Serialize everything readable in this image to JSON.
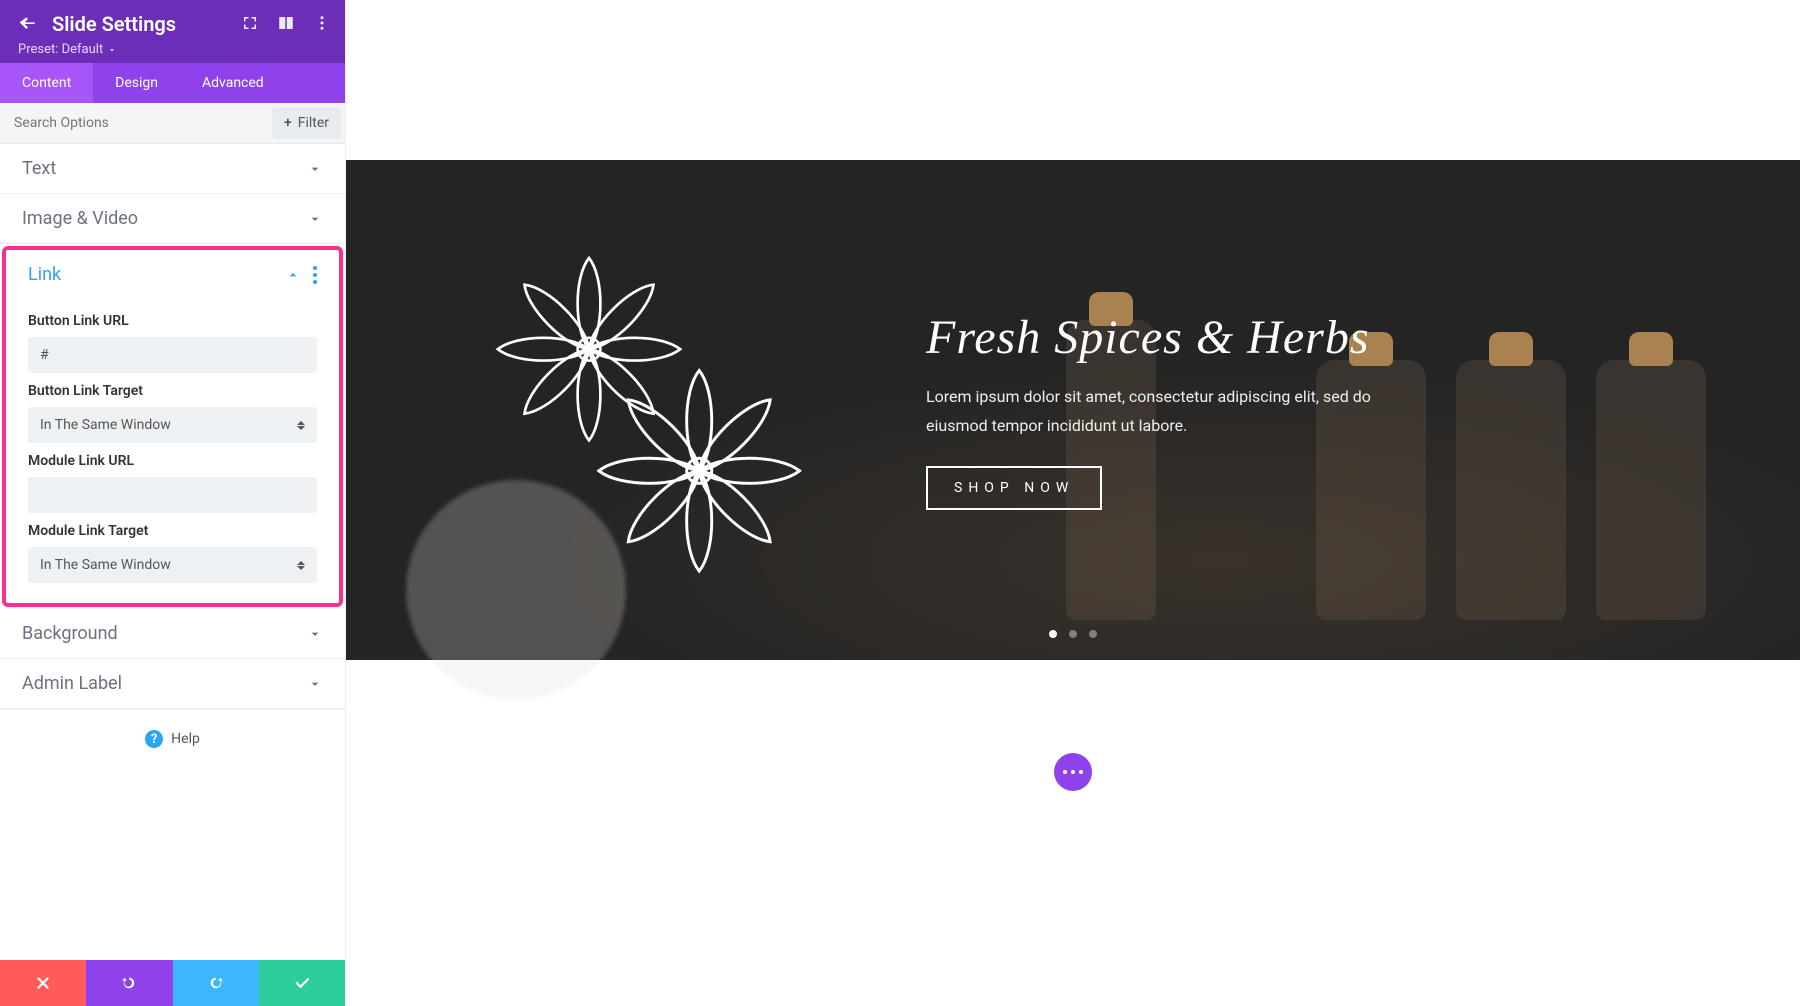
{
  "panel": {
    "title": "Slide Settings",
    "preset_label": "Preset: Default"
  },
  "tabs": {
    "content": "Content",
    "design": "Design",
    "advanced": "Advanced"
  },
  "search": {
    "placeholder": "Search Options",
    "filter_label": "Filter"
  },
  "sections": {
    "text": "Text",
    "image_video": "Image & Video",
    "link": "Link",
    "background": "Background",
    "admin_label": "Admin Label"
  },
  "link": {
    "button_url_label": "Button Link URL",
    "button_url_value": "#",
    "button_target_label": "Button Link Target",
    "button_target_value": "In The Same Window",
    "module_url_label": "Module Link URL",
    "module_url_value": "",
    "module_target_label": "Module Link Target",
    "module_target_value": "In The Same Window"
  },
  "help_label": "Help",
  "hero": {
    "title": "Fresh Spices & Herbs",
    "desc": "Lorem ipsum dolor sit amet, consectetur adipiscing elit, sed do eiusmod tempor incididunt ut labore.",
    "button": "SHOP NOW"
  }
}
